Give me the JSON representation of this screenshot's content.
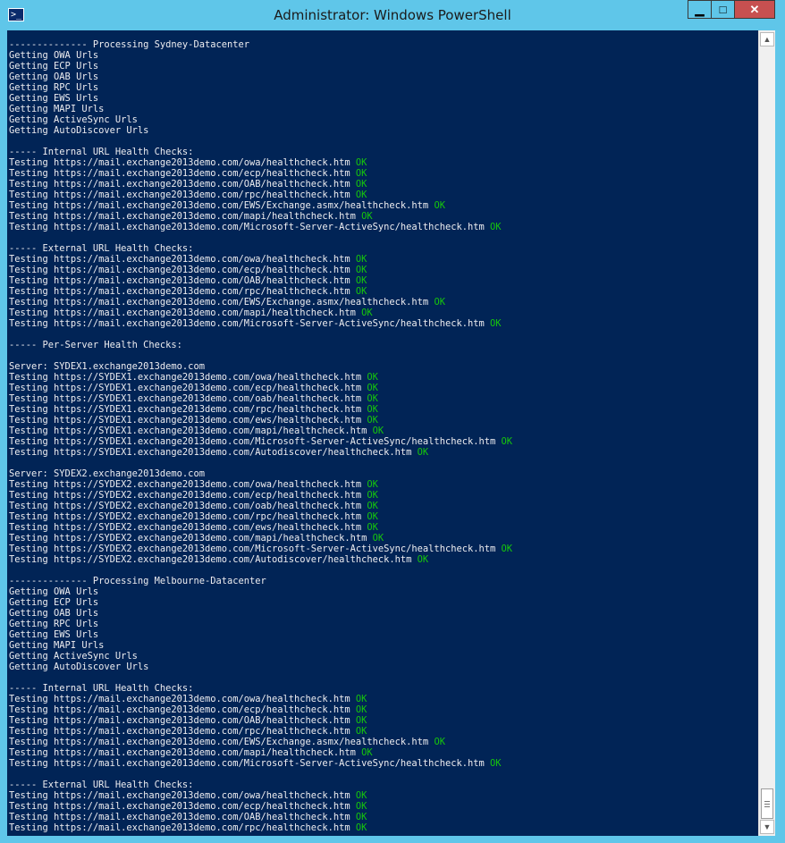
{
  "window": {
    "title": "Administrator: Windows PowerShell",
    "icon": "powershell-icon",
    "controls": {
      "minimize": "▁",
      "maximize": "□",
      "close": "✕"
    }
  },
  "colors": {
    "console_bg": "#012456",
    "text": "#eeedf0",
    "ok": "#16c60c",
    "titlebar": "#5fc6e9"
  },
  "console": {
    "lines": [
      {
        "text": "-------------- Processing Sydney-Datacenter"
      },
      {
        "text": "Getting OWA Urls"
      },
      {
        "text": "Getting ECP Urls"
      },
      {
        "text": "Getting OAB Urls"
      },
      {
        "text": "Getting RPC Urls"
      },
      {
        "text": "Getting EWS Urls"
      },
      {
        "text": "Getting MAPI Urls"
      },
      {
        "text": "Getting ActiveSync Urls"
      },
      {
        "text": "Getting AutoDiscover Urls"
      },
      {
        "text": ""
      },
      {
        "text": "----- Internal URL Health Checks:"
      },
      {
        "text": "Testing https://mail.exchange2013demo.com/owa/healthcheck.htm ",
        "status": "OK"
      },
      {
        "text": "Testing https://mail.exchange2013demo.com/ecp/healthcheck.htm ",
        "status": "OK"
      },
      {
        "text": "Testing https://mail.exchange2013demo.com/OAB/healthcheck.htm ",
        "status": "OK"
      },
      {
        "text": "Testing https://mail.exchange2013demo.com/rpc/healthcheck.htm ",
        "status": "OK"
      },
      {
        "text": "Testing https://mail.exchange2013demo.com/EWS/Exchange.asmx/healthcheck.htm ",
        "status": "OK"
      },
      {
        "text": "Testing https://mail.exchange2013demo.com/mapi/healthcheck.htm ",
        "status": "OK"
      },
      {
        "text": "Testing https://mail.exchange2013demo.com/Microsoft-Server-ActiveSync/healthcheck.htm ",
        "status": "OK"
      },
      {
        "text": ""
      },
      {
        "text": "----- External URL Health Checks:"
      },
      {
        "text": "Testing https://mail.exchange2013demo.com/owa/healthcheck.htm ",
        "status": "OK"
      },
      {
        "text": "Testing https://mail.exchange2013demo.com/ecp/healthcheck.htm ",
        "status": "OK"
      },
      {
        "text": "Testing https://mail.exchange2013demo.com/OAB/healthcheck.htm ",
        "status": "OK"
      },
      {
        "text": "Testing https://mail.exchange2013demo.com/rpc/healthcheck.htm ",
        "status": "OK"
      },
      {
        "text": "Testing https://mail.exchange2013demo.com/EWS/Exchange.asmx/healthcheck.htm ",
        "status": "OK"
      },
      {
        "text": "Testing https://mail.exchange2013demo.com/mapi/healthcheck.htm ",
        "status": "OK"
      },
      {
        "text": "Testing https://mail.exchange2013demo.com/Microsoft-Server-ActiveSync/healthcheck.htm ",
        "status": "OK"
      },
      {
        "text": ""
      },
      {
        "text": "----- Per-Server Health Checks:"
      },
      {
        "text": ""
      },
      {
        "text": "Server: SYDEX1.exchange2013demo.com"
      },
      {
        "text": "Testing https://SYDEX1.exchange2013demo.com/owa/healthcheck.htm ",
        "status": "OK"
      },
      {
        "text": "Testing https://SYDEX1.exchange2013demo.com/ecp/healthcheck.htm ",
        "status": "OK"
      },
      {
        "text": "Testing https://SYDEX1.exchange2013demo.com/oab/healthcheck.htm ",
        "status": "OK"
      },
      {
        "text": "Testing https://SYDEX1.exchange2013demo.com/rpc/healthcheck.htm ",
        "status": "OK"
      },
      {
        "text": "Testing https://SYDEX1.exchange2013demo.com/ews/healthcheck.htm ",
        "status": "OK"
      },
      {
        "text": "Testing https://SYDEX1.exchange2013demo.com/mapi/healthcheck.htm ",
        "status": "OK"
      },
      {
        "text": "Testing https://SYDEX1.exchange2013demo.com/Microsoft-Server-ActiveSync/healthcheck.htm ",
        "status": "OK"
      },
      {
        "text": "Testing https://SYDEX1.exchange2013demo.com/Autodiscover/healthcheck.htm ",
        "status": "OK"
      },
      {
        "text": ""
      },
      {
        "text": "Server: SYDEX2.exchange2013demo.com"
      },
      {
        "text": "Testing https://SYDEX2.exchange2013demo.com/owa/healthcheck.htm ",
        "status": "OK"
      },
      {
        "text": "Testing https://SYDEX2.exchange2013demo.com/ecp/healthcheck.htm ",
        "status": "OK"
      },
      {
        "text": "Testing https://SYDEX2.exchange2013demo.com/oab/healthcheck.htm ",
        "status": "OK"
      },
      {
        "text": "Testing https://SYDEX2.exchange2013demo.com/rpc/healthcheck.htm ",
        "status": "OK"
      },
      {
        "text": "Testing https://SYDEX2.exchange2013demo.com/ews/healthcheck.htm ",
        "status": "OK"
      },
      {
        "text": "Testing https://SYDEX2.exchange2013demo.com/mapi/healthcheck.htm ",
        "status": "OK"
      },
      {
        "text": "Testing https://SYDEX2.exchange2013demo.com/Microsoft-Server-ActiveSync/healthcheck.htm ",
        "status": "OK"
      },
      {
        "text": "Testing https://SYDEX2.exchange2013demo.com/Autodiscover/healthcheck.htm ",
        "status": "OK"
      },
      {
        "text": ""
      },
      {
        "text": "-------------- Processing Melbourne-Datacenter"
      },
      {
        "text": "Getting OWA Urls"
      },
      {
        "text": "Getting ECP Urls"
      },
      {
        "text": "Getting OAB Urls"
      },
      {
        "text": "Getting RPC Urls"
      },
      {
        "text": "Getting EWS Urls"
      },
      {
        "text": "Getting MAPI Urls"
      },
      {
        "text": "Getting ActiveSync Urls"
      },
      {
        "text": "Getting AutoDiscover Urls"
      },
      {
        "text": ""
      },
      {
        "text": "----- Internal URL Health Checks:"
      },
      {
        "text": "Testing https://mail.exchange2013demo.com/owa/healthcheck.htm ",
        "status": "OK"
      },
      {
        "text": "Testing https://mail.exchange2013demo.com/ecp/healthcheck.htm ",
        "status": "OK"
      },
      {
        "text": "Testing https://mail.exchange2013demo.com/OAB/healthcheck.htm ",
        "status": "OK"
      },
      {
        "text": "Testing https://mail.exchange2013demo.com/rpc/healthcheck.htm ",
        "status": "OK"
      },
      {
        "text": "Testing https://mail.exchange2013demo.com/EWS/Exchange.asmx/healthcheck.htm ",
        "status": "OK"
      },
      {
        "text": "Testing https://mail.exchange2013demo.com/mapi/healthcheck.htm ",
        "status": "OK"
      },
      {
        "text": "Testing https://mail.exchange2013demo.com/Microsoft-Server-ActiveSync/healthcheck.htm ",
        "status": "OK"
      },
      {
        "text": ""
      },
      {
        "text": "----- External URL Health Checks:"
      },
      {
        "text": "Testing https://mail.exchange2013demo.com/owa/healthcheck.htm ",
        "status": "OK"
      },
      {
        "text": "Testing https://mail.exchange2013demo.com/ecp/healthcheck.htm ",
        "status": "OK"
      },
      {
        "text": "Testing https://mail.exchange2013demo.com/OAB/healthcheck.htm ",
        "status": "OK"
      },
      {
        "text": "Testing https://mail.exchange2013demo.com/rpc/healthcheck.htm ",
        "status": "OK"
      }
    ]
  },
  "scrollbar": {
    "up_arrow": "▲",
    "down_arrow": "▼"
  }
}
